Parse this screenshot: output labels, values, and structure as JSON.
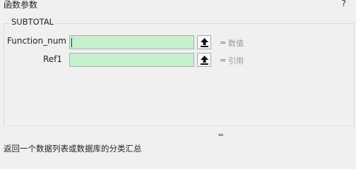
{
  "dialog": {
    "title": "函数参数",
    "help_label": "?"
  },
  "function": {
    "name": "SUBTOTAL",
    "args": [
      {
        "label": "Function_num",
        "value": "",
        "equals": "=",
        "hint": "数值"
      },
      {
        "label": "Ref1",
        "value": "",
        "equals": "=",
        "hint": "引用"
      }
    ],
    "result_equals": "=",
    "description": "返回一个数据列表或数据库的分类汇总"
  },
  "colors": {
    "field_fill": "#c6efce",
    "background": "#f0f0f0"
  },
  "icons": {
    "ref_button": "collapse-dialog-arrow-icon"
  }
}
